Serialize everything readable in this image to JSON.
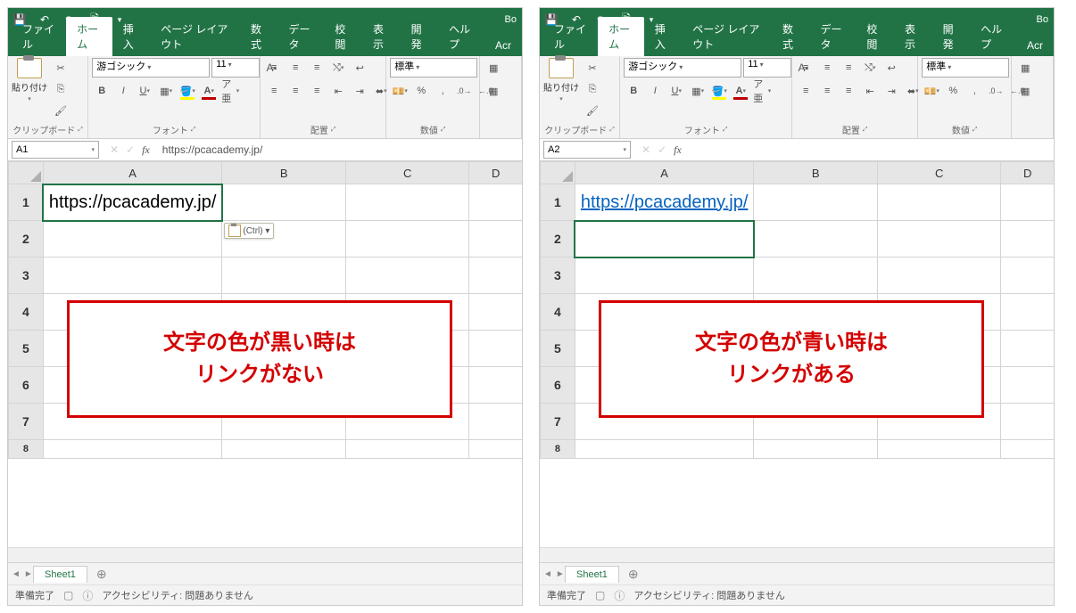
{
  "titlebar": {
    "app_indicator": "Bo"
  },
  "tabs": [
    "ファイル",
    "ホーム",
    "挿入",
    "ページ レイアウト",
    "数式",
    "データ",
    "校閲",
    "表示",
    "開発",
    "ヘルプ",
    "Acr"
  ],
  "ribbon": {
    "clipboard": {
      "paste": "貼り付け",
      "label": "クリップボード"
    },
    "font": {
      "name": "游ゴシック",
      "size": "11",
      "label": "フォント"
    },
    "align": {
      "label": "配置"
    },
    "number": {
      "format": "標準",
      "label": "数値"
    }
  },
  "left": {
    "cell_ref": "A1",
    "formula": "https://pcacademy.jp/",
    "cell_value": "https://pcacademy.jp/",
    "paste_badge": "(Ctrl) ▾",
    "annotation": "文字の色が黒い時は\nリンクがない"
  },
  "right": {
    "cell_ref": "A2",
    "formula": "",
    "cell_value": "https://pcacademy.jp/",
    "annotation": "文字の色が青い時は\nリンクがある"
  },
  "columns": [
    "A",
    "B",
    "C",
    "D"
  ],
  "rows": [
    "1",
    "2",
    "3",
    "4",
    "5",
    "6",
    "7",
    "8"
  ],
  "sheet": {
    "name": "Sheet1"
  },
  "status": {
    "ready": "準備完了",
    "accessibility": "アクセシビリティ: 問題ありません"
  }
}
